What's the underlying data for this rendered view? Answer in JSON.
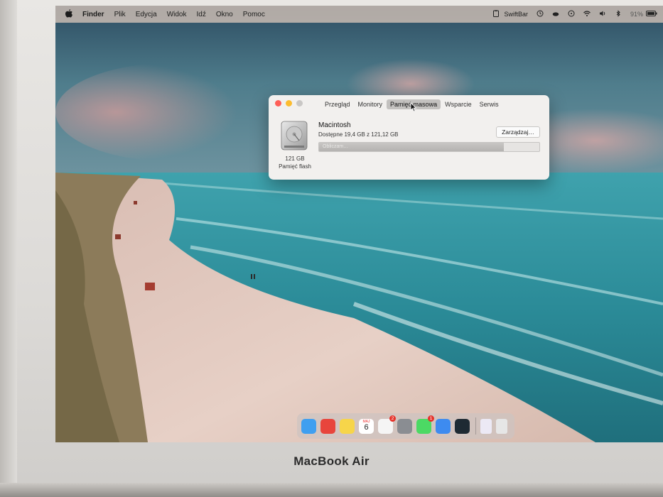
{
  "device": {
    "brand": "MacBook Air"
  },
  "menubar": {
    "app": "Finder",
    "items": [
      "Plik",
      "Edycja",
      "Widok",
      "Idź",
      "Okno",
      "Pomoc"
    ],
    "status": {
      "swiftbar": "SwiftBar",
      "battery": "91%"
    }
  },
  "about_window": {
    "tabs": [
      "Przegląd",
      "Monitory",
      "Pamięć masowa",
      "Wsparcie",
      "Serwis"
    ],
    "active_tab_index": 2,
    "disk": {
      "name": "Macintosh",
      "available": "Dostępne 19,4 GB z 121,12 GB",
      "size": "121 GB",
      "type": "Pamięć flash",
      "bar_label": "Obliczam…",
      "used_fraction": 0.84
    },
    "manage_button": "Zarządzaj…"
  },
  "dock": {
    "apps": [
      {
        "name": "finder-icon",
        "color": "#3f9ff0"
      },
      {
        "name": "chrome-icon",
        "color": "#e8453c"
      },
      {
        "name": "notes-icon",
        "color": "#f7d54a"
      },
      {
        "name": "calendar-icon",
        "color": "#ffffff",
        "month": "MAJ",
        "day": "6"
      },
      {
        "name": "reminders-icon",
        "color": "#f5f5f5",
        "badge": "2"
      },
      {
        "name": "system-preferences-icon",
        "color": "#8a8d92"
      },
      {
        "name": "messages-icon",
        "color": "#4cd964",
        "badge": "1"
      },
      {
        "name": "mail-icon",
        "color": "#3d8bf0"
      },
      {
        "name": "script-editor-icon",
        "color": "#1e2a33"
      },
      {
        "name": "document-icon",
        "color": "#ece9f5"
      },
      {
        "name": "trash-icon",
        "color": "#e6e6e6"
      }
    ]
  }
}
